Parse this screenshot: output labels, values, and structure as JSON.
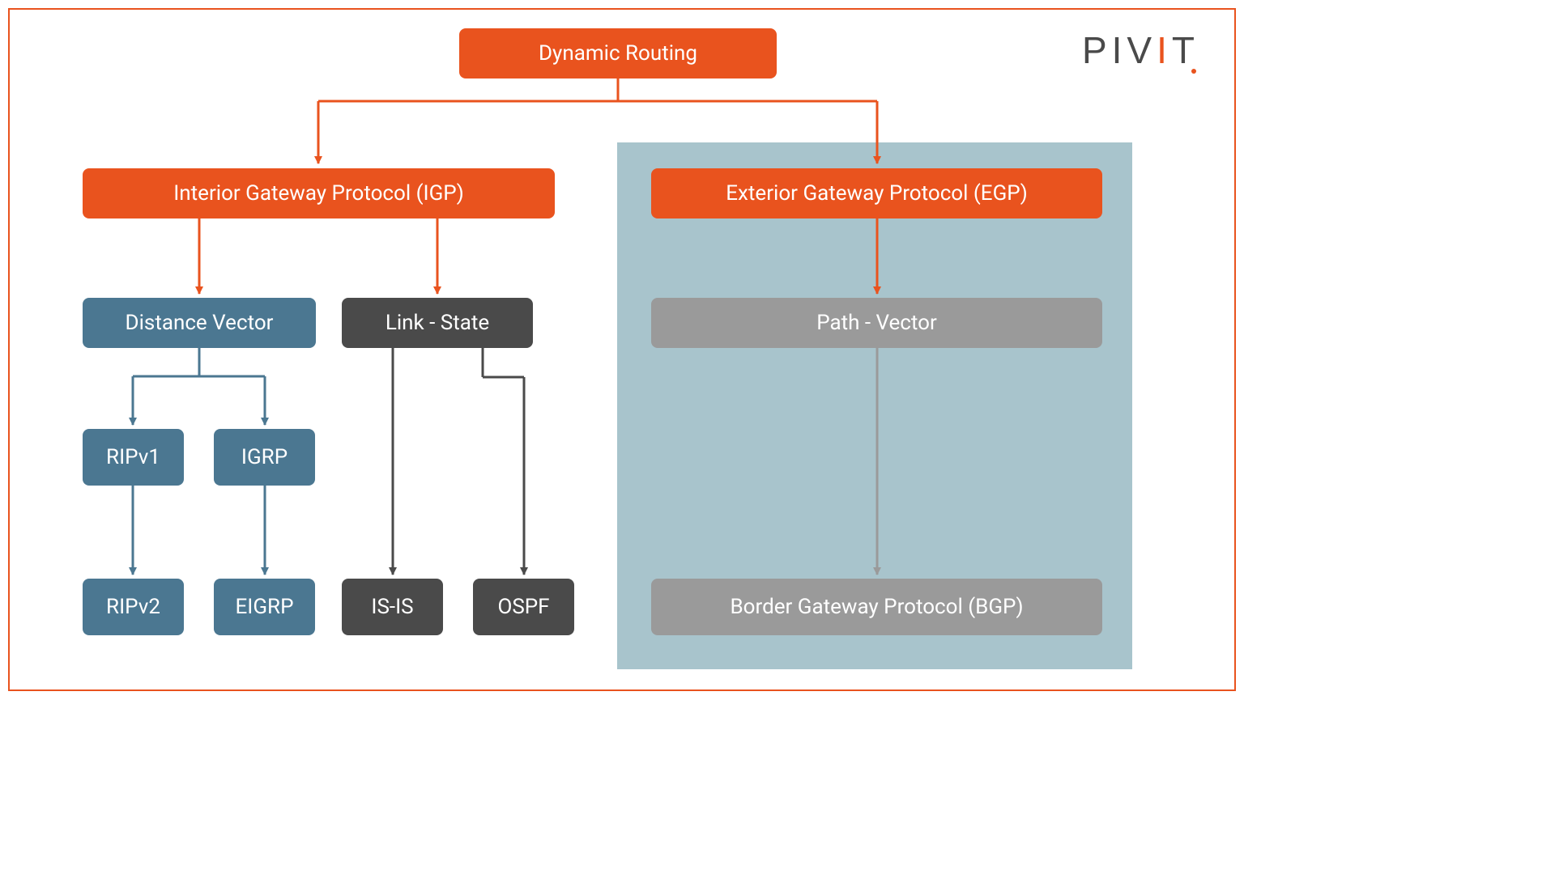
{
  "logo": {
    "text_plain": "PIVIT"
  },
  "colors": {
    "primary": "#e9531e",
    "blue": "#4b7791",
    "dark": "#4a4a4a",
    "gray": "#9a9a9a",
    "shade": "#a8c4cc"
  },
  "root": {
    "label": "Dynamic Routing"
  },
  "igp": {
    "label": "Interior Gateway Protocol (IGP)",
    "distance_vector": {
      "label": "Distance Vector",
      "ripv1": "RIPv1",
      "ripv2": "RIPv2",
      "igrp": "IGRP",
      "eigrp": "EIGRP"
    },
    "link_state": {
      "label": "Link - State",
      "isis": "IS-IS",
      "ospf": "OSPF"
    }
  },
  "egp": {
    "label": "Exterior Gateway Protocol (EGP)",
    "path_vector": {
      "label": "Path - Vector",
      "bgp": "Border Gateway Protocol (BGP)"
    }
  }
}
